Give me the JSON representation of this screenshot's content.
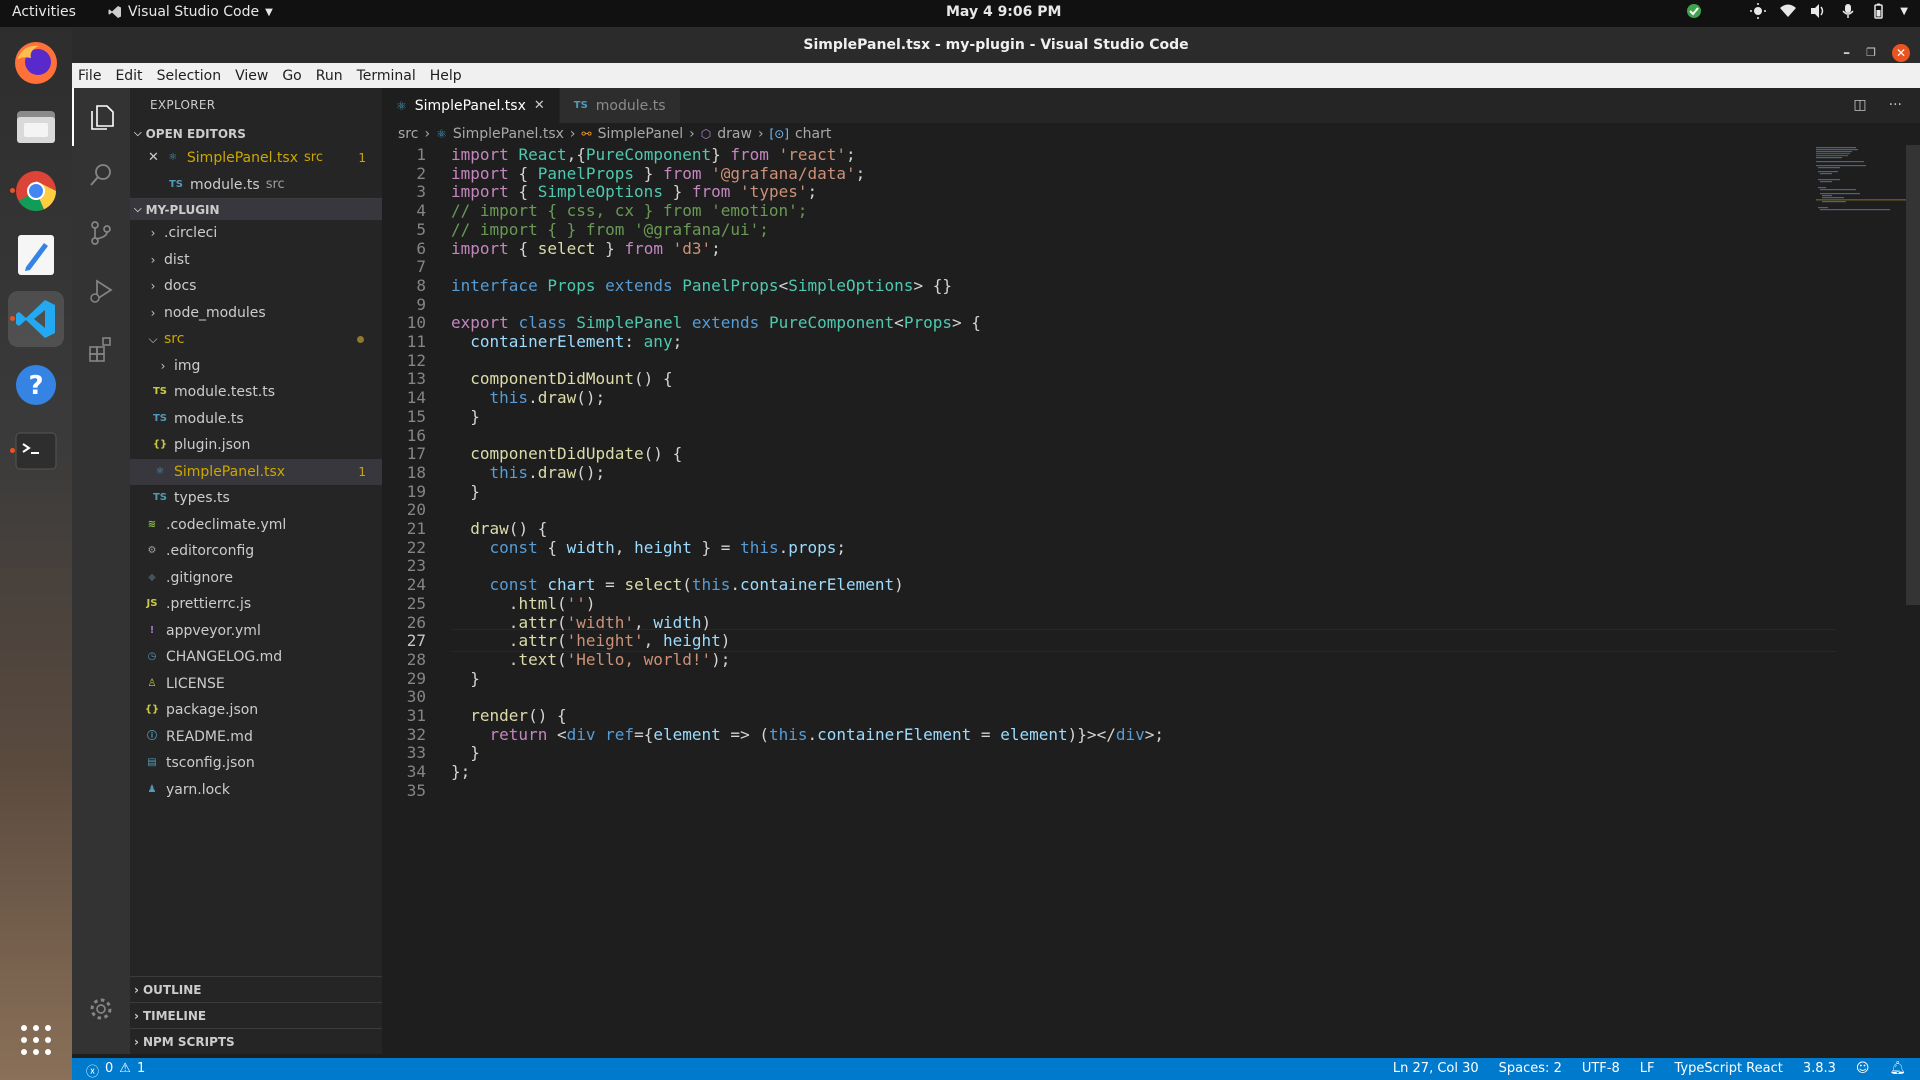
{
  "topbar": {
    "activities": "Activities",
    "app_name": "Visual Studio Code",
    "clock": "May 4  9:06 PM"
  },
  "window": {
    "title": "SimplePanel.tsx - my-plugin - Visual Studio Code",
    "menu": [
      "File",
      "Edit",
      "Selection",
      "View",
      "Go",
      "Run",
      "Terminal",
      "Help"
    ]
  },
  "sidebar": {
    "title": "EXPLORER",
    "open_editors": {
      "label": "OPEN EDITORS",
      "items": [
        {
          "name": "SimplePanel.tsx",
          "dir": "src",
          "badge": "1"
        },
        {
          "name": "module.ts",
          "dir": "src"
        }
      ]
    },
    "project": {
      "label": "MY-PLUGIN",
      "folders": [
        ".circleci",
        "dist",
        "docs",
        "node_modules"
      ],
      "src_folder": "src",
      "src_children": {
        "img": "img",
        "files": [
          "module.test.ts",
          "module.ts",
          "plugin.json",
          "SimplePanel.tsx",
          "types.ts"
        ],
        "selected_badge": "1"
      },
      "root_files": [
        ".codeclimate.yml",
        ".editorconfig",
        ".gitignore",
        ".prettierrc.js",
        "appveyor.yml",
        "CHANGELOG.md",
        "LICENSE",
        "package.json",
        "README.md",
        "tsconfig.json",
        "yarn.lock"
      ]
    },
    "bottom_sections": [
      "OUTLINE",
      "TIMELINE",
      "NPM SCRIPTS"
    ]
  },
  "editor": {
    "tabs": [
      {
        "label": "SimplePanel.tsx",
        "active": true
      },
      {
        "label": "module.ts",
        "active": false
      }
    ],
    "breadcrumb": [
      "src",
      "SimplePanel.tsx",
      "SimplePanel",
      "draw",
      "chart"
    ],
    "code": [
      "import React,{PureComponent} from 'react';",
      "import { PanelProps } from '@grafana/data';",
      "import { SimpleOptions } from 'types';",
      "// import { css, cx } from 'emotion';",
      "// import { } from '@grafana/ui';",
      "import { select } from 'd3';",
      "",
      "interface Props extends PanelProps<SimpleOptions> {}",
      "",
      "export class SimplePanel extends PureComponent<Props> {",
      "  containerElement: any;",
      "",
      "  componentDidMount() {",
      "    this.draw();",
      "  }",
      "",
      "  componentDidUpdate() {",
      "    this.draw();",
      "  }",
      "",
      "  draw() {",
      "    const { width, height } = this.props;",
      "",
      "    const chart = select(this.containerElement)",
      "      .html('')",
      "      .attr('width', width)",
      "      .attr('height', height)",
      "      .text('Hello, world!');",
      "  }",
      "",
      "  render() {",
      "    return <div ref={element => (this.containerElement = element)}></div>;",
      "  }",
      "};",
      ""
    ],
    "current_line": 27
  },
  "statusbar": {
    "errors": "0",
    "warnings": "1",
    "position": "Ln 27, Col 30",
    "spaces": "Spaces: 2",
    "encoding": "UTF-8",
    "eol": "LF",
    "language": "TypeScript React",
    "version": "3.8.3"
  },
  "colors": {
    "accent": "#007acc",
    "warning": "#cca700",
    "ts_icon": "#519aba",
    "json_icon": "#cbcb41"
  }
}
